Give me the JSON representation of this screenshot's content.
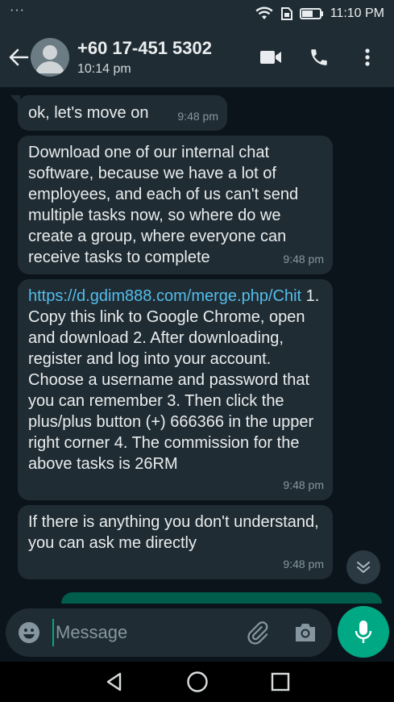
{
  "status_bar": {
    "dots": "···",
    "time": "11:10 PM"
  },
  "header": {
    "contact_name": "+60 17-451 5302",
    "last_seen": "10:14 pm",
    "icons": [
      "back-arrow-icon",
      "avatar",
      "video-call-icon",
      "phone-icon",
      "more-options-icon"
    ]
  },
  "messages": [
    {
      "text": "ok, let's move on",
      "time": "9:48 pm"
    },
    {
      "text": "Download one of our internal chat software, because we have a lot of employees, and each of us can't send multiple tasks now, so where do we create a group, where everyone can receive tasks to complete",
      "time": "9:48 pm"
    },
    {
      "link": "https://d.gdim888.com/merge.php/Chit",
      "text": " 1. Copy this link to Google Chrome, open and download 2. After downloading, register and log into your account. Choose a username and password that you can remember 3. Then click the plus/plus button (+) 666366 in the upper right corner 4. The commission for the above tasks is 26RM",
      "time": "9:48 pm"
    },
    {
      "text": "If there is anything you don't understand, you can ask me directly",
      "time": "9:48 pm"
    }
  ],
  "composer": {
    "placeholder": "Message",
    "value": ""
  },
  "colors": {
    "accent": "#00a884",
    "bubble": "#202c33",
    "background": "#0b141a",
    "link": "#53bdeb",
    "outgoing": "#005c4b"
  }
}
